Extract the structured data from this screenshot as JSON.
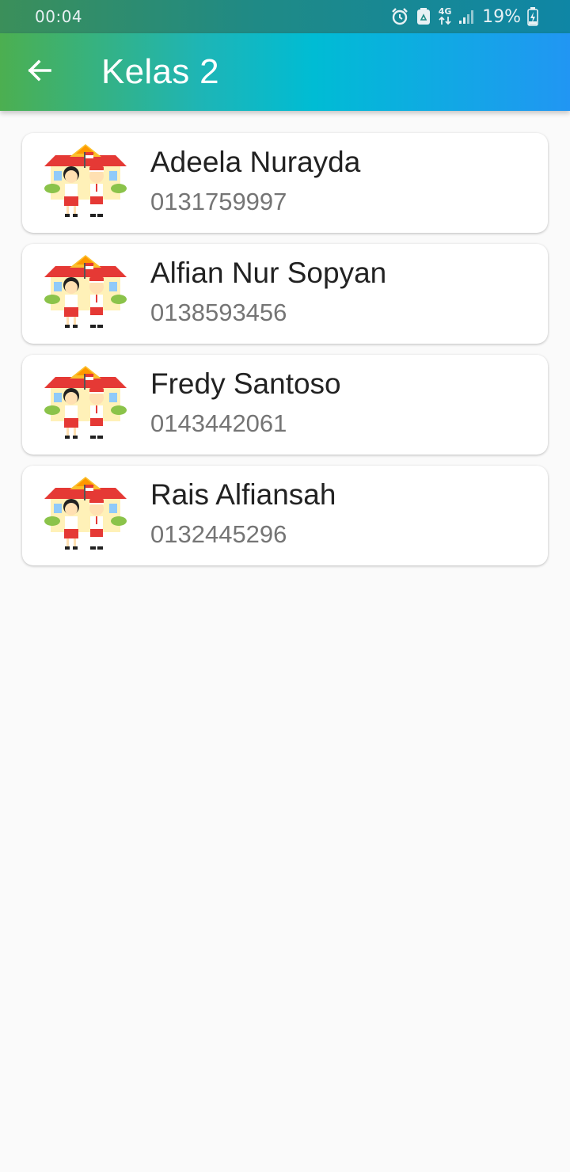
{
  "status_bar": {
    "time": "00:04",
    "network_label": "4G",
    "battery_percent": "19%",
    "icons": [
      "alarm-icon",
      "recycle-icon",
      "network-4g-icon",
      "signal-icon",
      "battery-charging-icon"
    ]
  },
  "app_bar": {
    "title": "Kelas 2",
    "back_icon": "arrow-left-icon"
  },
  "students": [
    {
      "name": "Adeela Nurayda",
      "id": "0131759997",
      "avatar_icon": "school-children-icon"
    },
    {
      "name": "Alfian Nur Sopyan",
      "id": "0138593456",
      "avatar_icon": "school-children-icon"
    },
    {
      "name": "Fredy Santoso",
      "id": "0143442061",
      "avatar_icon": "school-children-icon"
    },
    {
      "name": "Rais Alfiansah",
      "id": "0132445296",
      "avatar_icon": "school-children-icon"
    }
  ],
  "colors": {
    "app_bar_gradient_start": "#4caf50",
    "app_bar_gradient_mid": "#00bcd4",
    "app_bar_gradient_end": "#2196f3",
    "background": "#fafafa",
    "card": "#ffffff",
    "name_text": "#222222",
    "id_text": "#757575"
  }
}
